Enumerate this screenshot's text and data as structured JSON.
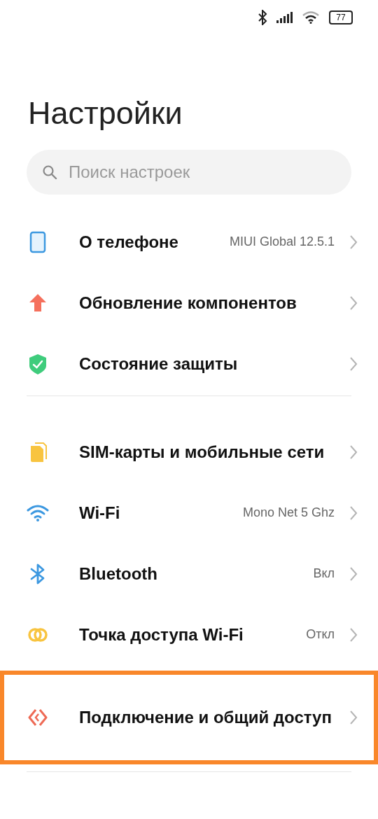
{
  "status_bar": {
    "battery": "77"
  },
  "title": "Настройки",
  "search": {
    "placeholder": "Поиск настроек"
  },
  "groups": [
    {
      "items": [
        {
          "kind": "phone",
          "label": "О телефоне",
          "value": "MIUI Global 12.5.1",
          "highlighted": false
        },
        {
          "kind": "update",
          "label": "Обновление компонентов",
          "highlighted": false
        },
        {
          "kind": "shield",
          "label": "Состояние защиты",
          "highlighted": false
        }
      ]
    },
    {
      "items": [
        {
          "kind": "sim",
          "label": "SIM-карты и мобильные сети",
          "highlighted": false
        },
        {
          "kind": "wifi",
          "label": "Wi-Fi",
          "value": "Mono Net 5 Ghz",
          "highlighted": false
        },
        {
          "kind": "bluetooth",
          "label": "Bluetooth",
          "value": "Вкл",
          "highlighted": false
        },
        {
          "kind": "hotspot",
          "label": "Точка доступа Wi-Fi",
          "value": "Откл",
          "highlighted": false
        },
        {
          "kind": "share",
          "label": "Подключение и общий доступ",
          "highlighted": true
        }
      ]
    }
  ]
}
